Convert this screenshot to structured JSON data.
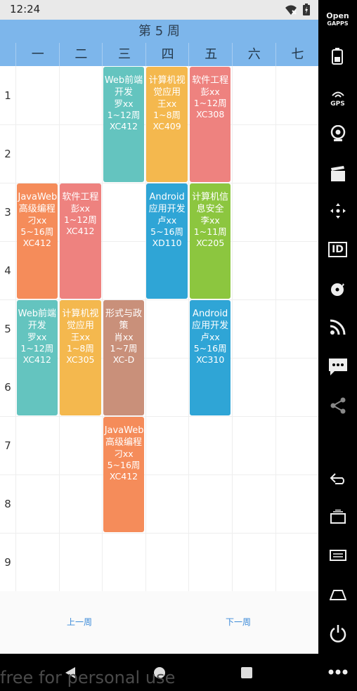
{
  "status": {
    "time": "12:24"
  },
  "title": "第 5 周",
  "days": [
    "一",
    "二",
    "三",
    "四",
    "五",
    "六",
    "七"
  ],
  "periods": [
    "1",
    "2",
    "3",
    "4",
    "5",
    "6",
    "7",
    "8",
    "9"
  ],
  "courses": [
    {
      "day": 3,
      "start": 1,
      "span": 2,
      "color": "#64c4bf",
      "name": "Web前端开发",
      "teacher": "罗xx",
      "weeks": "1~12周",
      "room": "XC412"
    },
    {
      "day": 4,
      "start": 1,
      "span": 2,
      "color": "#f4b84e",
      "name": "计算机视觉应用",
      "teacher": "王xx",
      "weeks": "1~8周",
      "room": "XC409"
    },
    {
      "day": 5,
      "start": 1,
      "span": 2,
      "color": "#ee827f",
      "name": "软件工程",
      "teacher": "彭xx",
      "weeks": "1~12周",
      "room": "XC308"
    },
    {
      "day": 1,
      "start": 3,
      "span": 2,
      "color": "#f58c5a",
      "name": "JavaWeb高级编程",
      "teacher": "刁xx",
      "weeks": "5~16周",
      "room": "XC412"
    },
    {
      "day": 2,
      "start": 3,
      "span": 2,
      "color": "#ee827f",
      "name": "软件工程",
      "teacher": "彭xx",
      "weeks": "1~12周",
      "room": "XC412"
    },
    {
      "day": 4,
      "start": 3,
      "span": 2,
      "color": "#2fa5d6",
      "name": "Android应用开发",
      "teacher": "卢xx",
      "weeks": "5~16周",
      "room": "XD110"
    },
    {
      "day": 5,
      "start": 3,
      "span": 2,
      "color": "#8cc63f",
      "name": "计算机信息安全",
      "teacher": "李xx",
      "weeks": "1~11周",
      "room": "XC205"
    },
    {
      "day": 1,
      "start": 5,
      "span": 2,
      "color": "#64c4bf",
      "name": "Web前端开发",
      "teacher": "罗xx",
      "weeks": "1~12周",
      "room": "XC412"
    },
    {
      "day": 2,
      "start": 5,
      "span": 2,
      "color": "#f4b84e",
      "name": "计算机视觉应用",
      "teacher": "王xx",
      "weeks": "1~8周",
      "room": "XC305"
    },
    {
      "day": 3,
      "start": 5,
      "span": 2,
      "color": "#c9907a",
      "name": "形式与政策",
      "teacher": "肖xx",
      "weeks": "1~7周",
      "room": "XC-D"
    },
    {
      "day": 5,
      "start": 5,
      "span": 2,
      "color": "#2fa5d6",
      "name": "Android应用开发",
      "teacher": "卢xx",
      "weeks": "5~16周",
      "room": "XC310"
    },
    {
      "day": 3,
      "start": 7,
      "span": 2,
      "color": "#f58c5a",
      "name": "JavaWeb高级编程",
      "teacher": "刁xx",
      "weeks": "5~16周",
      "room": "XC412"
    }
  ],
  "footer": {
    "prev": "上一周",
    "next": "下一周"
  },
  "watermark": "free for personal use",
  "sidebar": {
    "top_label_1": "Open",
    "top_label_2": "GAPPS",
    "gps_label": "GPS",
    "id_label": "ID"
  }
}
